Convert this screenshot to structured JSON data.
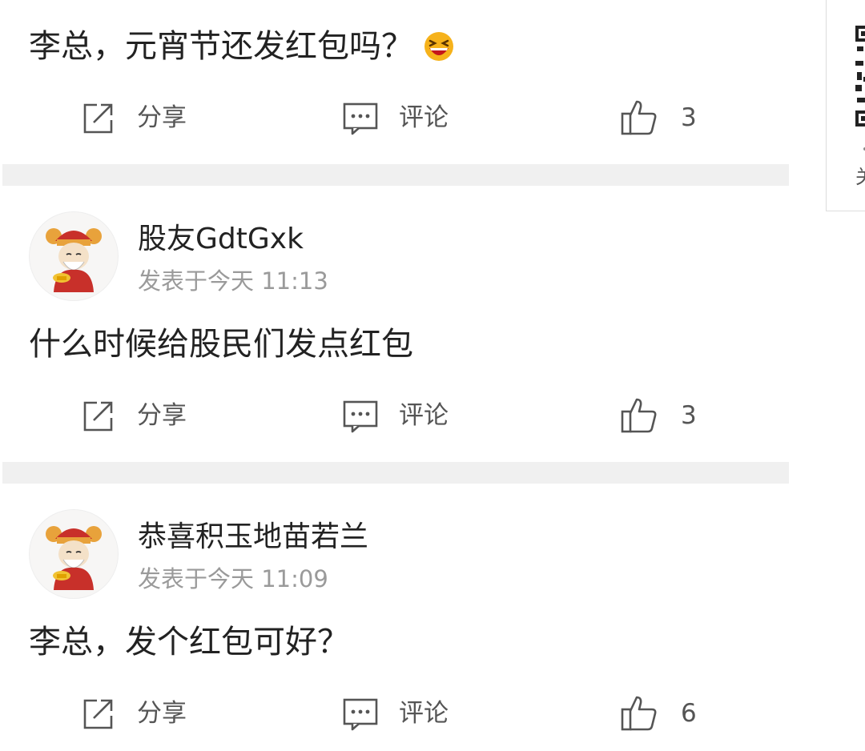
{
  "posts": [
    {
      "username": "",
      "time": "",
      "content": "李总，元宵节还发红包吗？",
      "has_emoji": true,
      "emoji": "grinning-squint-emoji",
      "actions": {
        "share": "分享",
        "comment": "评论",
        "likes": "3"
      }
    },
    {
      "username": "股友GdtGxk",
      "time": "发表于今天 11:13",
      "content": "什么时候给股民们发点红包",
      "avatar": "god-of-wealth-avatar",
      "actions": {
        "share": "分享",
        "comment": "评论",
        "likes": "3"
      }
    },
    {
      "username": "恭喜积玉地苗若兰",
      "time": "发表于今天 11:09",
      "content": "李总，发个红包可好？",
      "avatar": "god-of-wealth-avatar",
      "actions": {
        "share": "分享",
        "comment": "评论",
        "likes": "6"
      }
    }
  ],
  "side_card": {
    "caption_fragment": "关"
  },
  "colors": {
    "divider": "#f0f0f0",
    "text": "#222222",
    "meta": "#9a9a9a",
    "action": "#555555"
  }
}
